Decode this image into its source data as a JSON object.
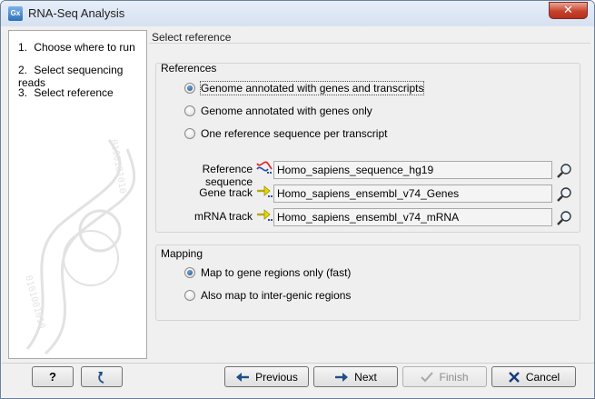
{
  "window": {
    "title": "RNA-Seq Analysis",
    "app_icon_text": "Gx",
    "close_symbol": "✕"
  },
  "steps": [
    {
      "num": "1.",
      "label": "Choose where to run"
    },
    {
      "num": "2.",
      "label": "Select sequencing reads"
    },
    {
      "num": "3.",
      "label": "Select reference"
    }
  ],
  "panel": {
    "title": "Select reference"
  },
  "references": {
    "group_label": "References",
    "options": [
      {
        "label": "Genome annotated with genes and transcripts",
        "checked": true
      },
      {
        "label": "Genome annotated with genes only",
        "checked": false
      },
      {
        "label": "One reference sequence per transcript",
        "checked": false
      }
    ],
    "fields": [
      {
        "label": "Reference sequence",
        "value": "Homo_sapiens_sequence_hg19",
        "icon": "sequence-icon"
      },
      {
        "label": "Gene track",
        "value": "Homo_sapiens_ensembl_v74_Genes",
        "icon": "track-icon"
      },
      {
        "label": "mRNA track",
        "value": "Homo_sapiens_ensembl_v74_mRNA",
        "icon": "track-icon"
      }
    ]
  },
  "mapping": {
    "group_label": "Mapping",
    "options": [
      {
        "label": "Map to gene regions only (fast)",
        "checked": true
      },
      {
        "label": "Also map to inter-genic regions",
        "checked": false
      }
    ]
  },
  "buttons": {
    "help": "?",
    "previous": "Previous",
    "next": "Next",
    "finish": "Finish",
    "cancel": "Cancel"
  },
  "colors": {
    "accent_blue": "#1f4f86",
    "close_red": "#c7432d",
    "cancel_x": "#1a3a7a"
  }
}
